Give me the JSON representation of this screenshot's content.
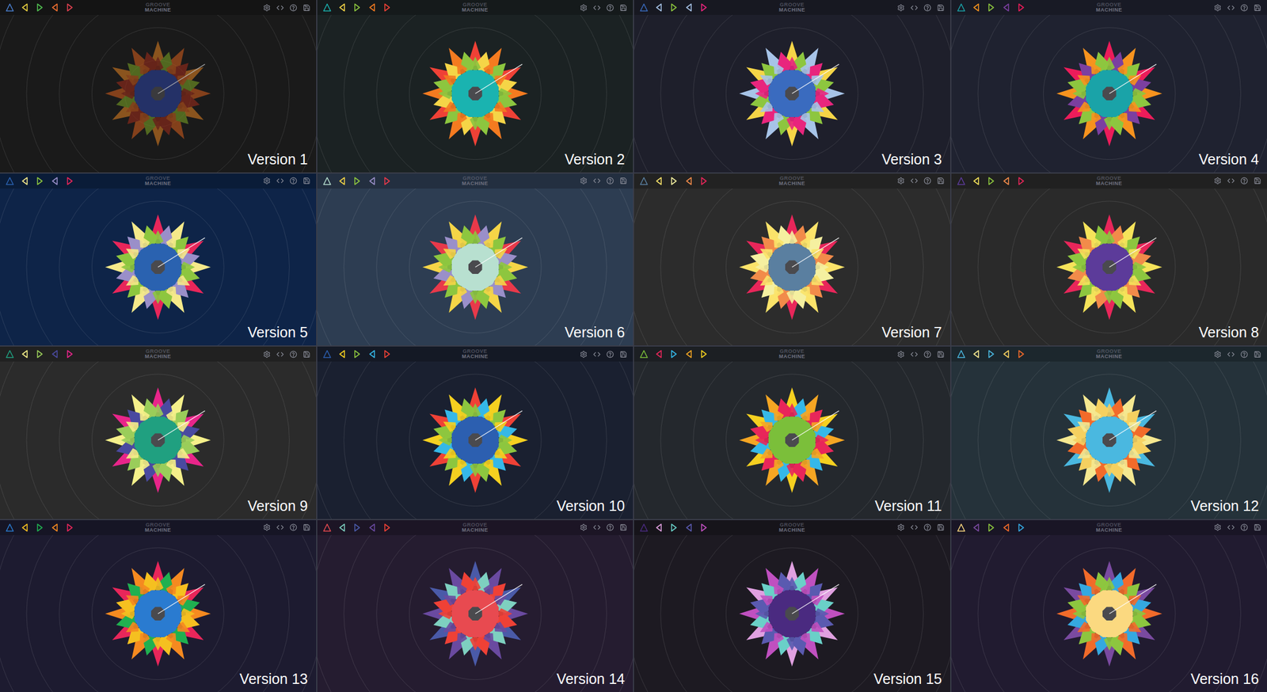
{
  "versions": [
    {
      "label": "Version 1",
      "logo": {
        "top": "GROOVE",
        "bottom": "MACHINE"
      },
      "dimmed": true,
      "background": "#1a1a1a",
      "center": "#2a3c8c",
      "petals": [
        "#b5521c",
        "#6b8e23",
        "#8b2a1a",
        "#c07020"
      ],
      "icons": [
        "#4a7fd0",
        "#e8d040",
        "#50c050",
        "#f07030",
        "#e04050"
      ]
    },
    {
      "label": "Version 2",
      "logo": {
        "top": "GROOVE",
        "bottom": "MACHINE"
      },
      "dimmed": false,
      "background": "#1b2223",
      "center": "#1ab3b0",
      "petals": [
        "#f47b20",
        "#f5d547",
        "#8cc63f",
        "#ef4136"
      ],
      "icons": [
        "#1ab3b0",
        "#f5d547",
        "#8cc63f",
        "#f47b20",
        "#ef4136"
      ]
    },
    {
      "label": "Version 3",
      "logo": {
        "top": "GROOVE",
        "bottom": "MACHINE"
      },
      "dimmed": false,
      "background": "#1e1f2b",
      "center": "#3a6bbf",
      "petals": [
        "#a7c4e8",
        "#8dc63f",
        "#e8257d",
        "#f5d547"
      ],
      "icons": [
        "#3a6bbf",
        "#a7c4e8",
        "#8dc63f",
        "#a7c4e8",
        "#e8257d"
      ]
    },
    {
      "label": "Version 4",
      "logo": {
        "top": "GROOVE",
        "bottom": "MACHINE"
      },
      "dimmed": false,
      "background": "#1f2230",
      "center": "#1aa3a8",
      "petals": [
        "#f7931e",
        "#7b3fa0",
        "#8dc63f",
        "#ec1c5a"
      ],
      "icons": [
        "#1aa3a8",
        "#f7931e",
        "#8dc63f",
        "#7b3fa0",
        "#ec1c5a"
      ]
    },
    {
      "label": "Version 5",
      "logo": {
        "top": "GROOVE",
        "bottom": "MACHINE"
      },
      "dimmed": false,
      "background": "#0e2448",
      "center": "#2a62b0",
      "petals": [
        "#f5e98a",
        "#9a8fc9",
        "#8dc63f",
        "#e8265a"
      ],
      "icons": [
        "#2a62b0",
        "#f5e98a",
        "#8dc63f",
        "#9a8fc9",
        "#e8265a"
      ]
    },
    {
      "label": "Version 6",
      "logo": {
        "top": "GROOVE",
        "bottom": "MACHINE"
      },
      "dimmed": false,
      "background": "#2d3d52",
      "center": "#b8e0d0",
      "petals": [
        "#f5d547",
        "#9a8fc9",
        "#8dc63f",
        "#e8394a"
      ],
      "icons": [
        "#b8e0d0",
        "#f5d547",
        "#8dc63f",
        "#9a8fc9",
        "#e8394a"
      ]
    },
    {
      "label": "Version 7",
      "logo": {
        "top": "GROOVE",
        "bottom": "MACHINE"
      },
      "dimmed": false,
      "background": "#2c2c2c",
      "center": "#5a7fa0",
      "petals": [
        "#fbe36a",
        "#f28b4a",
        "#f5f0a0",
        "#e8265a"
      ],
      "icons": [
        "#5a7fa0",
        "#fbe36a",
        "#f5f0a0",
        "#f28b4a",
        "#e8265a"
      ]
    },
    {
      "label": "Version 8",
      "logo": {
        "top": "GROOVE",
        "bottom": "MACHINE"
      },
      "dimmed": false,
      "background": "#2a2a2a",
      "center": "#5c3b9a",
      "petals": [
        "#f5e35a",
        "#f28b4a",
        "#8dc63f",
        "#e8265a"
      ],
      "icons": [
        "#5c3b9a",
        "#f5e35a",
        "#8dc63f",
        "#f28b4a",
        "#e8265a"
      ]
    },
    {
      "label": "Version 9",
      "logo": {
        "top": "GROOVE",
        "bottom": "MACHINE"
      },
      "dimmed": false,
      "background": "#2b2b2b",
      "center": "#20a080",
      "petals": [
        "#f5f08a",
        "#4a4aa0",
        "#9acd5a",
        "#e8258a"
      ],
      "icons": [
        "#20a080",
        "#f5f08a",
        "#9acd5a",
        "#4a4aa0",
        "#e8258a"
      ]
    },
    {
      "label": "Version 10",
      "logo": {
        "top": "GROOVE",
        "bottom": "MACHINE"
      },
      "dimmed": false,
      "background": "#1a2030",
      "center": "#2c5fb0",
      "petals": [
        "#f5d020",
        "#35b8e8",
        "#8dc63f",
        "#ef4136"
      ],
      "icons": [
        "#2c5fb0",
        "#f5d020",
        "#8dc63f",
        "#35b8e8",
        "#ef4136"
      ]
    },
    {
      "label": "Version 11",
      "logo": {
        "top": "GROOVE",
        "bottom": "MACHINE"
      },
      "dimmed": false,
      "background": "#24282d",
      "center": "#7bbf3a",
      "petals": [
        "#f5a623",
        "#35b8e8",
        "#e8265a",
        "#f5d020"
      ],
      "icons": [
        "#7bbf3a",
        "#e8265a",
        "#35b8e8",
        "#f5a623",
        "#f5d020"
      ]
    },
    {
      "label": "Version 12",
      "logo": {
        "top": "GROOVE",
        "bottom": "MACHINE"
      },
      "dimmed": false,
      "background": "#25323a",
      "center": "#4ab8e0",
      "petals": [
        "#f5e890",
        "#f26b2a",
        "#f5d060",
        "#4ab8e0"
      ],
      "icons": [
        "#4ab8e0",
        "#f5e890",
        "#4ab8e0",
        "#f5d060",
        "#f26b2a"
      ]
    },
    {
      "label": "Version 13",
      "logo": {
        "top": "GROOVE",
        "bottom": "MACHINE"
      },
      "dimmed": false,
      "background": "#1d1b30",
      "center": "#2a7bd0",
      "petals": [
        "#f58a20",
        "#20b050",
        "#f5c020",
        "#e8265a"
      ],
      "icons": [
        "#2a7bd0",
        "#f5c020",
        "#20b050",
        "#f58a20",
        "#e8265a"
      ]
    },
    {
      "label": "Version 14",
      "logo": {
        "top": "GROOVE",
        "bottom": "MACHINE"
      },
      "dimmed": false,
      "background": "#251c30",
      "center": "#e84a50",
      "petals": [
        "#6a4aa0",
        "#7ed0c0",
        "#ef4136",
        "#4a5aa8"
      ],
      "icons": [
        "#e84a50",
        "#7ed0c0",
        "#4a5aa8",
        "#6a4aa0",
        "#ef4136"
      ]
    },
    {
      "label": "Version 15",
      "logo": {
        "top": "GROOVE",
        "bottom": "MACHINE"
      },
      "dimmed": false,
      "background": "#1d1a22",
      "center": "#4a2a80",
      "petals": [
        "#c050c0",
        "#6ad0c8",
        "#5a5ab0",
        "#e0a0e0"
      ],
      "icons": [
        "#4a2a80",
        "#e0a0e0",
        "#6ad0c8",
        "#5a5ab0",
        "#c050c0"
      ]
    },
    {
      "label": "Version 16",
      "logo": {
        "top": "GROOVE",
        "bottom": "MACHINE"
      },
      "dimmed": false,
      "background": "#211b30",
      "center": "#fbd980",
      "petals": [
        "#f26b2a",
        "#35a8e0",
        "#8dc63f",
        "#7a4aa0"
      ],
      "icons": [
        "#fbd980",
        "#7a4aa0",
        "#8dc63f",
        "#f26b2a",
        "#35a8e0"
      ]
    }
  ]
}
